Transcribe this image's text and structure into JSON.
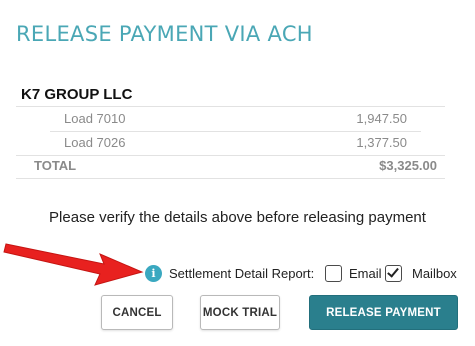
{
  "dialog": {
    "title": "RELEASE PAYMENT VIA ACH"
  },
  "payment": {
    "payee": "K7 GROUP LLC",
    "loads": [
      {
        "label": "Load 7010",
        "amount": "1,947.50"
      },
      {
        "label": "Load 7026",
        "amount": "1,377.50"
      }
    ],
    "total_label": "TOTAL",
    "total_amount": "$3,325.00"
  },
  "verify_text": "Please verify the details above before releasing payment",
  "report": {
    "info_icon": "info-icon",
    "label": "Settlement Detail Report:",
    "email_label": "Email",
    "email_checked": false,
    "mailbox_label": "Mailbox",
    "mailbox_checked": true
  },
  "buttons": {
    "cancel": "CANCEL",
    "mock_trial": "MOCK TRIAL",
    "release": "RELEASE PAYMENT"
  },
  "colors": {
    "title": "#4aa7b5",
    "primary_button": "#2a7f8d",
    "info_icon": "#3aa8c0",
    "annotation_arrow": "#e8211f"
  }
}
